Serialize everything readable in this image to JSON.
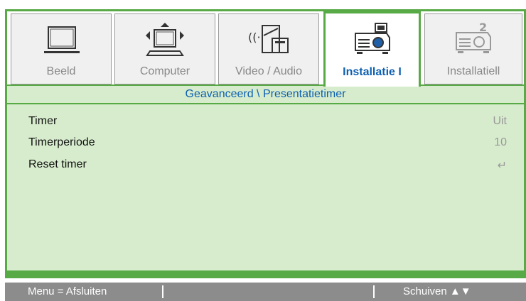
{
  "tabs": [
    {
      "label": "Beeld",
      "icon": "monitor-icon",
      "active": false
    },
    {
      "label": "Computer",
      "icon": "computer-icon",
      "active": false
    },
    {
      "label": "Video / Audio",
      "icon": "video-audio-icon",
      "active": false
    },
    {
      "label": "Installatie I",
      "icon": "projector-icon",
      "active": true
    },
    {
      "label": "Installatiell",
      "icon": "projector-settings-icon",
      "active": false
    }
  ],
  "breadcrumb": "Geavanceerd \\ Presentatietimer",
  "menu_items": [
    {
      "label": "Timer",
      "value": "Uit"
    },
    {
      "label": "Timerperiode",
      "value": "10"
    },
    {
      "label": "Reset timer",
      "value": "↵"
    }
  ],
  "footer": {
    "left": "Menu = Afsluiten",
    "right": "Schuiven ▲▼"
  },
  "colors": {
    "accent_green": "#58aa46",
    "panel_green": "#d7eccd",
    "active_text": "#0d5fb0"
  }
}
